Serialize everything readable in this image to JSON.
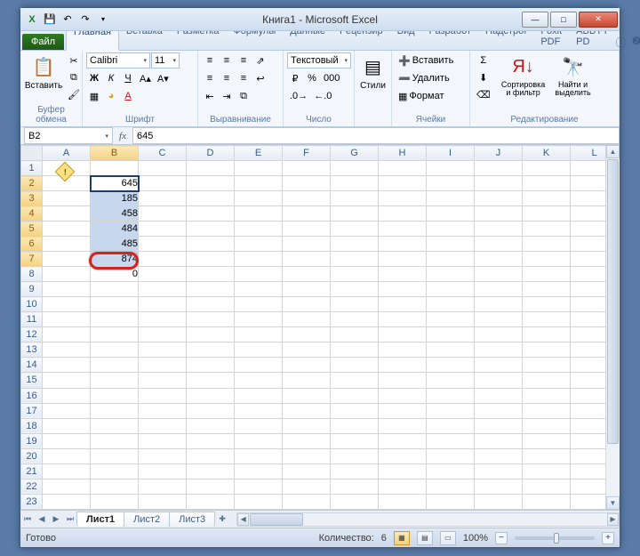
{
  "title": "Книга1 - Microsoft Excel",
  "qat": {
    "excel": "X",
    "save": "💾",
    "undo": "↶",
    "redo": "↷",
    "more": "▾"
  },
  "tabs": {
    "file": "Файл",
    "items": [
      "Главная",
      "Вставка",
      "Разметка",
      "Формулы",
      "Данные",
      "Рецензир",
      "Вид",
      "Разработ",
      "Надстрої",
      "Foxit PDF",
      "ABBYY PD"
    ],
    "activeIndex": 0
  },
  "ribbon": {
    "clipboard": {
      "paste": "Вставить",
      "label": "Буфер обмена"
    },
    "font": {
      "name": "Calibri",
      "size": "11",
      "label": "Шрифт"
    },
    "align": {
      "label": "Выравнивание",
      "format": "Текстовый"
    },
    "number": {
      "label": "Число"
    },
    "styles": {
      "btn": "Стили",
      "label": ""
    },
    "cells": {
      "insert": "Вставить",
      "delete": "Удалить",
      "format": "Формат",
      "label": "Ячейки"
    },
    "editing": {
      "sort": "Сортировка и фильтр",
      "find": "Найти и выделить",
      "label": "Редактирование"
    }
  },
  "namebox": "B2",
  "fx": "645",
  "columns": [
    "A",
    "B",
    "C",
    "D",
    "E",
    "F",
    "G",
    "H",
    "I",
    "J",
    "K",
    "L"
  ],
  "rows": 23,
  "selCol": "B",
  "selRows": [
    2,
    3,
    4,
    5,
    6,
    7
  ],
  "cells": {
    "B2": "645",
    "B3": "185",
    "B4": "458",
    "B5": "484",
    "B6": "485",
    "B7": "874",
    "B8": "0"
  },
  "sheets": {
    "items": [
      "Лист1",
      "Лист2",
      "Лист3"
    ],
    "activeIndex": 0
  },
  "status": {
    "ready": "Готово",
    "count_lbl": "Количество:",
    "count_val": "6",
    "zoom": "100%"
  },
  "winbtns": {
    "min": "—",
    "max": "□",
    "close": "✕",
    "mdimin": "–",
    "mdimax": "❐",
    "mdiclose": "×"
  },
  "chart_data": null
}
